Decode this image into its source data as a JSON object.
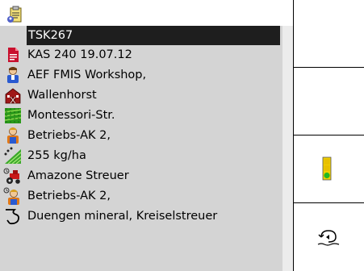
{
  "task_list": {
    "selected_task": "TSK267",
    "items": [
      {
        "icon": "document-icon",
        "label": "KAS 240 19.07.12"
      },
      {
        "icon": "customer-icon",
        "label": "AEF FMIS Workshop,"
      },
      {
        "icon": "farm-icon",
        "label": " Wallenhorst"
      },
      {
        "icon": "field-icon",
        "label": "Montessori-Str."
      },
      {
        "icon": "worker-icon",
        "label": "Betriebs-AK 2,"
      },
      {
        "icon": "rate-icon",
        "label": "255 kg/ha"
      },
      {
        "icon": "machine-icon",
        "label": "Amazone Streuer"
      },
      {
        "icon": "operator-icon",
        "label": "Betriebs-AK 2,"
      },
      {
        "icon": "operation-icon",
        "label": "Duengen mineral, Kreiselstreuer"
      }
    ]
  },
  "softkeys": {
    "status_icon": "traffic-light-icon",
    "back_icon": "back-return-icon"
  },
  "colors": {
    "list_background": "#d4d4d4",
    "selection_background": "#1e1e1e",
    "traffic_green": "#22b822",
    "traffic_yellow": "#f0d000"
  }
}
